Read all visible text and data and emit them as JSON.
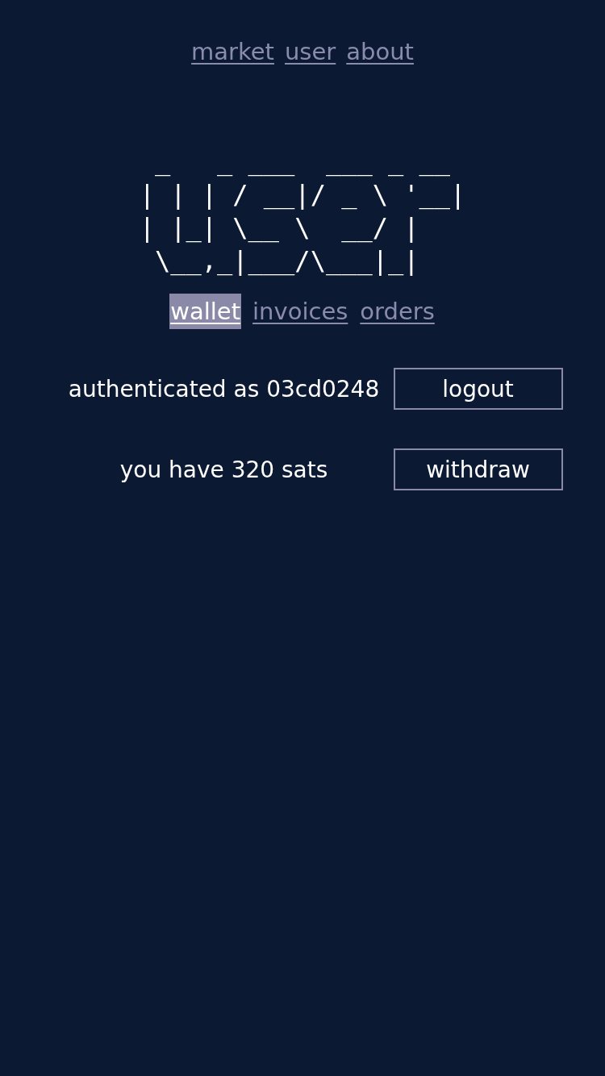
{
  "nav": [
    {
      "label": "market"
    },
    {
      "label": "user"
    },
    {
      "label": "about"
    }
  ],
  "ascii_art": [
    " _   _ ___  ___ _ __",
    "| | | / __|/ _ \\ '__|",
    "| |_| \\__ \\  __/ |",
    " \\__,_|___/\\___|_|"
  ],
  "tabs": [
    {
      "label": "wallet",
      "selected": true
    },
    {
      "label": "invoices",
      "selected": false
    },
    {
      "label": "orders",
      "selected": false
    }
  ],
  "rows": [
    {
      "text": "authenticated as 03cd0248",
      "button": "logout"
    },
    {
      "text": "you have 320 sats",
      "button": "withdraw"
    }
  ]
}
